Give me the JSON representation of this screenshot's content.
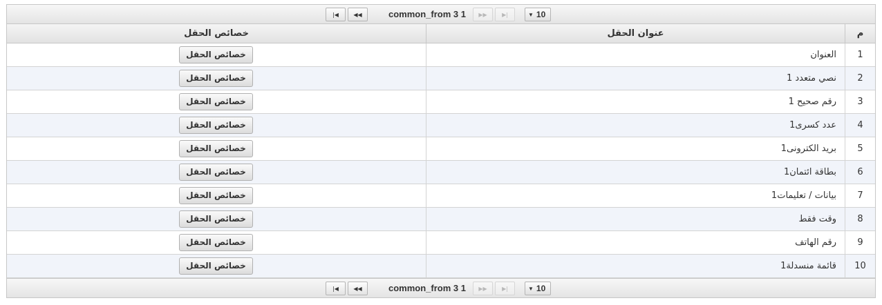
{
  "pager": {
    "text": "common_from 3 1",
    "page_size": "10",
    "first_icon": "first-page-icon",
    "prev_icon": "prev-page-icon",
    "next_icon": "next-page-icon",
    "last_icon": "last-page-icon"
  },
  "table": {
    "columns": {
      "num": "م",
      "title": "عنوان الحقل",
      "props": "خصائص الحقل"
    },
    "button_label": "خصائص الحقل",
    "rows": [
      {
        "num": "1",
        "title": "العنوان"
      },
      {
        "num": "2",
        "title": "نصي متعدد 1"
      },
      {
        "num": "3",
        "title": "رقم صحيح 1"
      },
      {
        "num": "4",
        "title": "عدد كسرى1"
      },
      {
        "num": "5",
        "title": "بريد الكترونى1"
      },
      {
        "num": "6",
        "title": "بطاقة ائتمان1"
      },
      {
        "num": "7",
        "title": "بيانات / تعليمات1"
      },
      {
        "num": "8",
        "title": "وقت فقط"
      },
      {
        "num": "9",
        "title": "رقم الهاتف"
      },
      {
        "num": "10",
        "title": "قائمة منسدلة1"
      }
    ]
  }
}
